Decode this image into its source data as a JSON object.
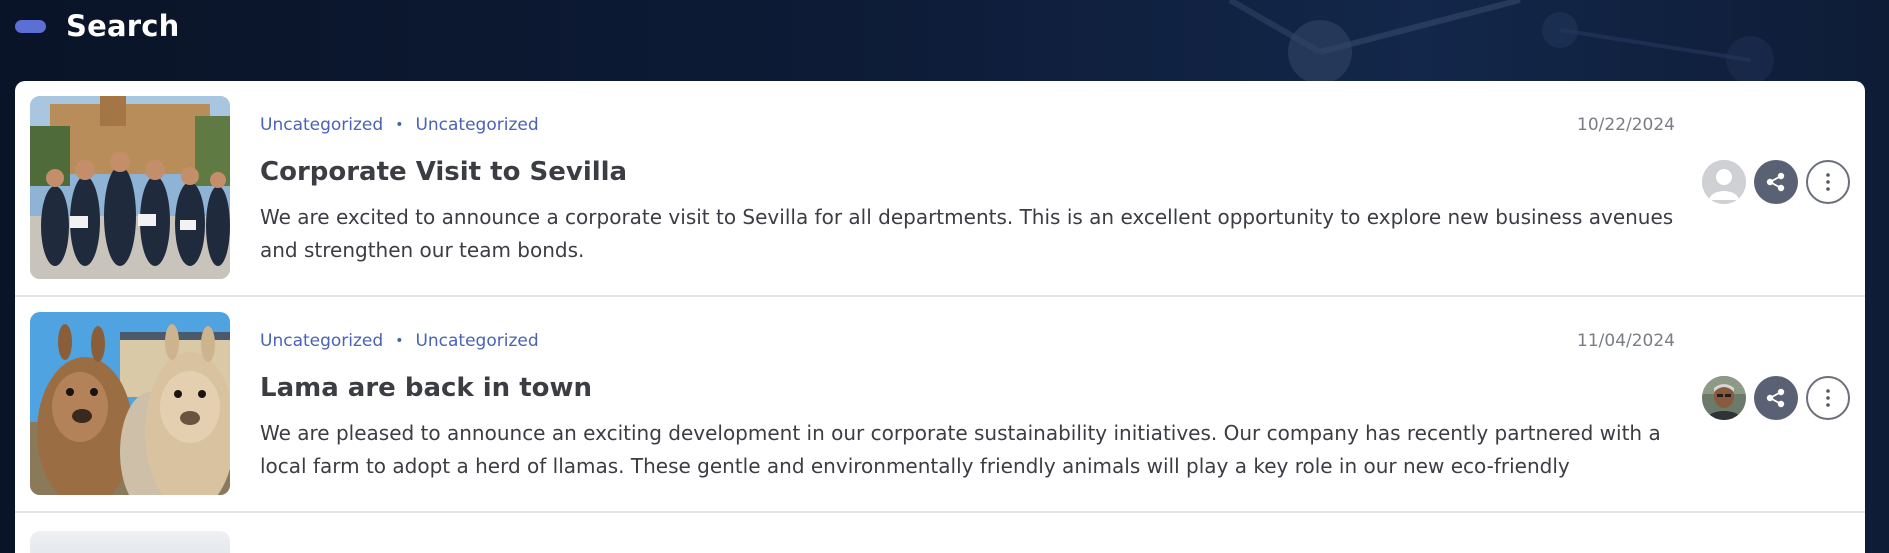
{
  "header": {
    "title": "Search"
  },
  "posts": [
    {
      "categories": [
        "Uncategorized",
        "Uncategorized"
      ],
      "date": "10/22/2024",
      "title": "Corporate Visit to Sevilla",
      "excerpt": "We are excited to announce a corporate visit to Sevilla for all departments. This is an excellent opportunity to explore new business avenues and strengthen our team bonds.",
      "avatar": "default-user-avatar"
    },
    {
      "categories": [
        "Uncategorized",
        "Uncategorized"
      ],
      "date": "11/04/2024",
      "title": "Lama are back in town",
      "excerpt": "We are pleased to announce an exciting development in our corporate sustainability initiatives. Our company has recently partnered with a local farm to adopt a herd of llamas. These gentle and environmentally friendly animals will play a key role in our new eco-friendly landscaping proje…",
      "avatar": "user-photo-avatar"
    }
  ],
  "icons": {
    "share": "share-icon",
    "more": "more-vertical-icon"
  },
  "colors": {
    "accent": "#4a62b7",
    "header_pill": "#5b6fd4",
    "share_button": "#5a6174"
  }
}
